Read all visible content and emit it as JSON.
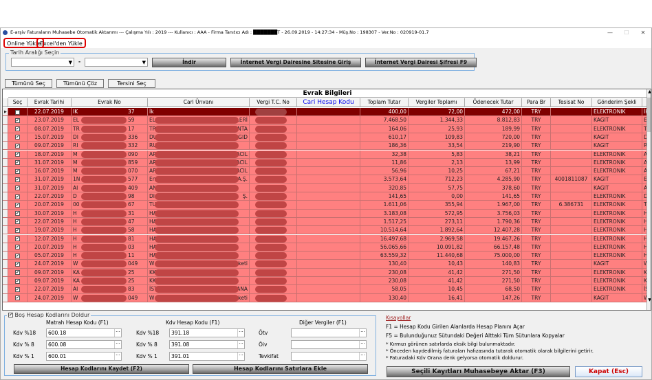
{
  "window": {
    "title": "E-arşiv Faturaların Muhasebe Otomatik Aktarımı  ---  Çalışma Yılı : 2019  ---  Kullanıcı : AAA - Firma Tanıtıcı Adı : ███████T - 26.09.2019 - 14:27:34 - Müş.No : 198307 - Ver.No : 020919-01.7",
    "minimize": "—",
    "maximize": "☐",
    "close": "✕"
  },
  "menu": {
    "online": "Online Yükle",
    "excel": "Excel'den Yükle"
  },
  "date_range": {
    "label": "Tarih Aralığı Seçin",
    "start": "",
    "end": "",
    "separator": "-",
    "download": "İndir",
    "site_login": "İnternet Vergi Dairesine Sitesine Giriş",
    "password": "İnternet Vergi Dairesi Şifresi F9"
  },
  "selection": {
    "select_all": "Tümünü Seç",
    "deselect_all": "Tümünü Çöz",
    "invert": "Tersini Seç"
  },
  "grid": {
    "title": "Evrak Bilgileri",
    "columns": [
      "Seç",
      "Evrak Tarihi",
      "Evrak No",
      "Cari Ünvanı",
      "Vergi T.C. No",
      "Cari Hesap Kodu",
      "Toplam Tutar",
      "Vergiler Toplamı",
      "Ödenecek Tutar",
      "Para Br",
      "Tesisat No",
      "Gönderim Şekli"
    ],
    "colors": {
      "row": "#ff8080",
      "selected": "#800000",
      "header_link": "#0000ee"
    },
    "rows": [
      [
        "22.07.2019",
        "IK",
        "37",
        "İk",
        "",
        "400,00",
        "72,00",
        "472,00",
        "TRY",
        "",
        "ELEKTRONIK",
        "İk"
      ],
      [
        "23.07.2019",
        "EL",
        "59",
        "EL",
        "TLERİ",
        "7.468,50",
        "1.344,33",
        "8.812,83",
        "TRY",
        "",
        "KAGIT",
        "El"
      ],
      [
        "08.07.2019",
        "TR",
        "17",
        "TR",
        "ENTA",
        "164,06",
        "25,93",
        "189,99",
        "TRY",
        "",
        "ELEKTRONIK",
        "Tİ"
      ],
      [
        "15.07.2019",
        "DI",
        "336",
        "DU",
        "E GID",
        "610,17",
        "109,83",
        "720,00",
        "TRY",
        "",
        "KAGIT",
        "D"
      ],
      [
        "09.07.2019",
        "RI",
        "332",
        "RU",
        "",
        "186,36",
        "33,54",
        "219,90",
        "TRY",
        "",
        "KAGIT",
        "R"
      ],
      [
        "18.07.2019",
        "M",
        "090",
        "AR",
        "MACIL",
        "32,38",
        "5,83",
        "38,21",
        "TRY",
        "",
        "ELEKTRONIK",
        "A"
      ],
      [
        "31.07.2019",
        "M",
        "859",
        "AR",
        "MACIL",
        "11,86",
        "2,13",
        "13,99",
        "TRY",
        "",
        "ELEKTRONIK",
        "A"
      ],
      [
        "16.07.2019",
        "M",
        "070",
        "AR",
        "MACIL",
        "56,96",
        "10,25",
        "67,21",
        "TRY",
        "",
        "ELEKTRONIK",
        "A"
      ],
      [
        "31.07.2019",
        "1N",
        "577",
        "En",
        "ş A.Ş.",
        "3.573,64",
        "712,23",
        "4.285,90",
        "TRY",
        "4001811087",
        "KAGIT",
        "Er"
      ],
      [
        "31.07.2019",
        "AI",
        "409",
        "AN",
        "",
        "320,85",
        "57,75",
        "378,60",
        "TRY",
        "",
        "KAGIT",
        "A"
      ],
      [
        "22.07.2019",
        "D",
        "98",
        "DI",
        "Ş.",
        "141,65",
        "0,00",
        "141,65",
        "TRY",
        "",
        "ELEKTRONIK",
        "D"
      ],
      [
        "20.07.2019",
        "00",
        "67",
        "TU",
        "",
        "1.611,06",
        "355,94",
        "1.967,00",
        "TRY",
        "6.386731",
        "ELEKTRONIK",
        "TI"
      ],
      [
        "30.07.2019",
        "H",
        "31",
        "HA",
        "",
        "3.183,08",
        "572,95",
        "3.756,03",
        "TRY",
        "",
        "ELEKTRONIK",
        "H"
      ],
      [
        "22.07.2019",
        "H",
        "47",
        "HA",
        "",
        "1.517,25",
        "273,11",
        "1.790,36",
        "TRY",
        "",
        "ELEKTRONIK",
        "H"
      ],
      [
        "19.07.2019",
        "H",
        "58",
        "HA",
        "",
        "10.514,64",
        "1.892,64",
        "12.407,28",
        "TRY",
        "",
        "ELEKTRONIK",
        "H"
      ],
      [
        "12.07.2019",
        "H",
        "81",
        "HA",
        "",
        "16.497,68",
        "2.969,58",
        "19.467,26",
        "TRY",
        "",
        "ELEKTRONIK",
        "H"
      ],
      [
        "20.07.2019",
        "H",
        "03",
        "HA",
        "",
        "56.065,66",
        "10.091,82",
        "66.157,48",
        "TRY",
        "",
        "ELEKTRONIK",
        "H"
      ],
      [
        "05.07.2019",
        "H",
        "11",
        "HA",
        "",
        "63.559,32",
        "11.440,68",
        "75.000,00",
        "TRY",
        "",
        "ELEKTRONIK",
        "H"
      ],
      [
        "24.07.2019",
        "W",
        "049",
        "W",
        "rketi",
        "130,40",
        "10,43",
        "140,83",
        "TRY",
        "",
        "KAGIT",
        "W"
      ],
      [
        "09.07.2019",
        "KA",
        "25",
        "KK",
        "",
        "230,08",
        "41,42",
        "271,50",
        "TRY",
        "",
        "ELEKTRONIK",
        "K"
      ],
      [
        "09.07.2019",
        "KA",
        "25",
        "KK",
        "",
        "230,08",
        "41,42",
        "271,50",
        "TRY",
        "",
        "ELEKTRONIK",
        "K"
      ],
      [
        "22.07.2019",
        "AI",
        "83",
        "İST",
        "SANA",
        "58,05",
        "10,45",
        "68,50",
        "TRY",
        "",
        "ELEKTRONIK",
        "İS"
      ],
      [
        "24.07.2019",
        "W",
        "049",
        "W",
        "rketi",
        "130,40",
        "16,41",
        "147,26",
        "TRY",
        "",
        "KAGIT",
        "W"
      ]
    ]
  },
  "codes": {
    "fill_label": "Boş Hesap Kodlarını Doldur",
    "fill_checked": true,
    "matrah_header": "Matrah Hesap Kodu (F1)",
    "kdv_header": "Kdv Hesap Kodu (F1)",
    "other_header": "Diğer Vergiler (F1)",
    "matrah": [
      {
        "label": "Kdv %18",
        "value": "600.18"
      },
      {
        "label": "Kdv % 8",
        "value": "600.08"
      },
      {
        "label": "Kdv % 1",
        "value": "600.01"
      }
    ],
    "kdv": [
      {
        "label": "Kdv %18",
        "value": "391.18"
      },
      {
        "label": "Kdv % 8",
        "value": "391.08"
      },
      {
        "label": "Kdv % 1",
        "value": "391.01"
      }
    ],
    "other": [
      {
        "label": "Ötv",
        "value": ""
      },
      {
        "label": "Öiv",
        "value": ""
      },
      {
        "label": "Tevkifat",
        "value": ""
      }
    ],
    "save": "Hesap Kodlarını Kaydet  (F2)",
    "apply": "Hesap Kodlarını Satırlara Ekle"
  },
  "shortcuts": {
    "title": "Kısayollar",
    "f1": "F1 = Hesap Kodu Girilen Alanlarda Hesap Planını Açar",
    "f5": "F5 = Bulunduğunuz Sütundaki Değeri Alttaki Tüm Sütunlara Kopyalar",
    "notes": [
      "* Kırmızı görünen satırlarda eksik bilgi bulunmaktadır.",
      "* Önceden kaydedilmiş faturaları hafızasında tutarak otomatik olarak bilgilerini getirir.",
      "* Faturadaki Kdv Orana denk gelyorsa otomatik doldurur."
    ]
  },
  "actions": {
    "transfer": "Seçili Kayıtları Muhasebeye Aktar (F3)",
    "close": "Kapat (Esc)"
  }
}
